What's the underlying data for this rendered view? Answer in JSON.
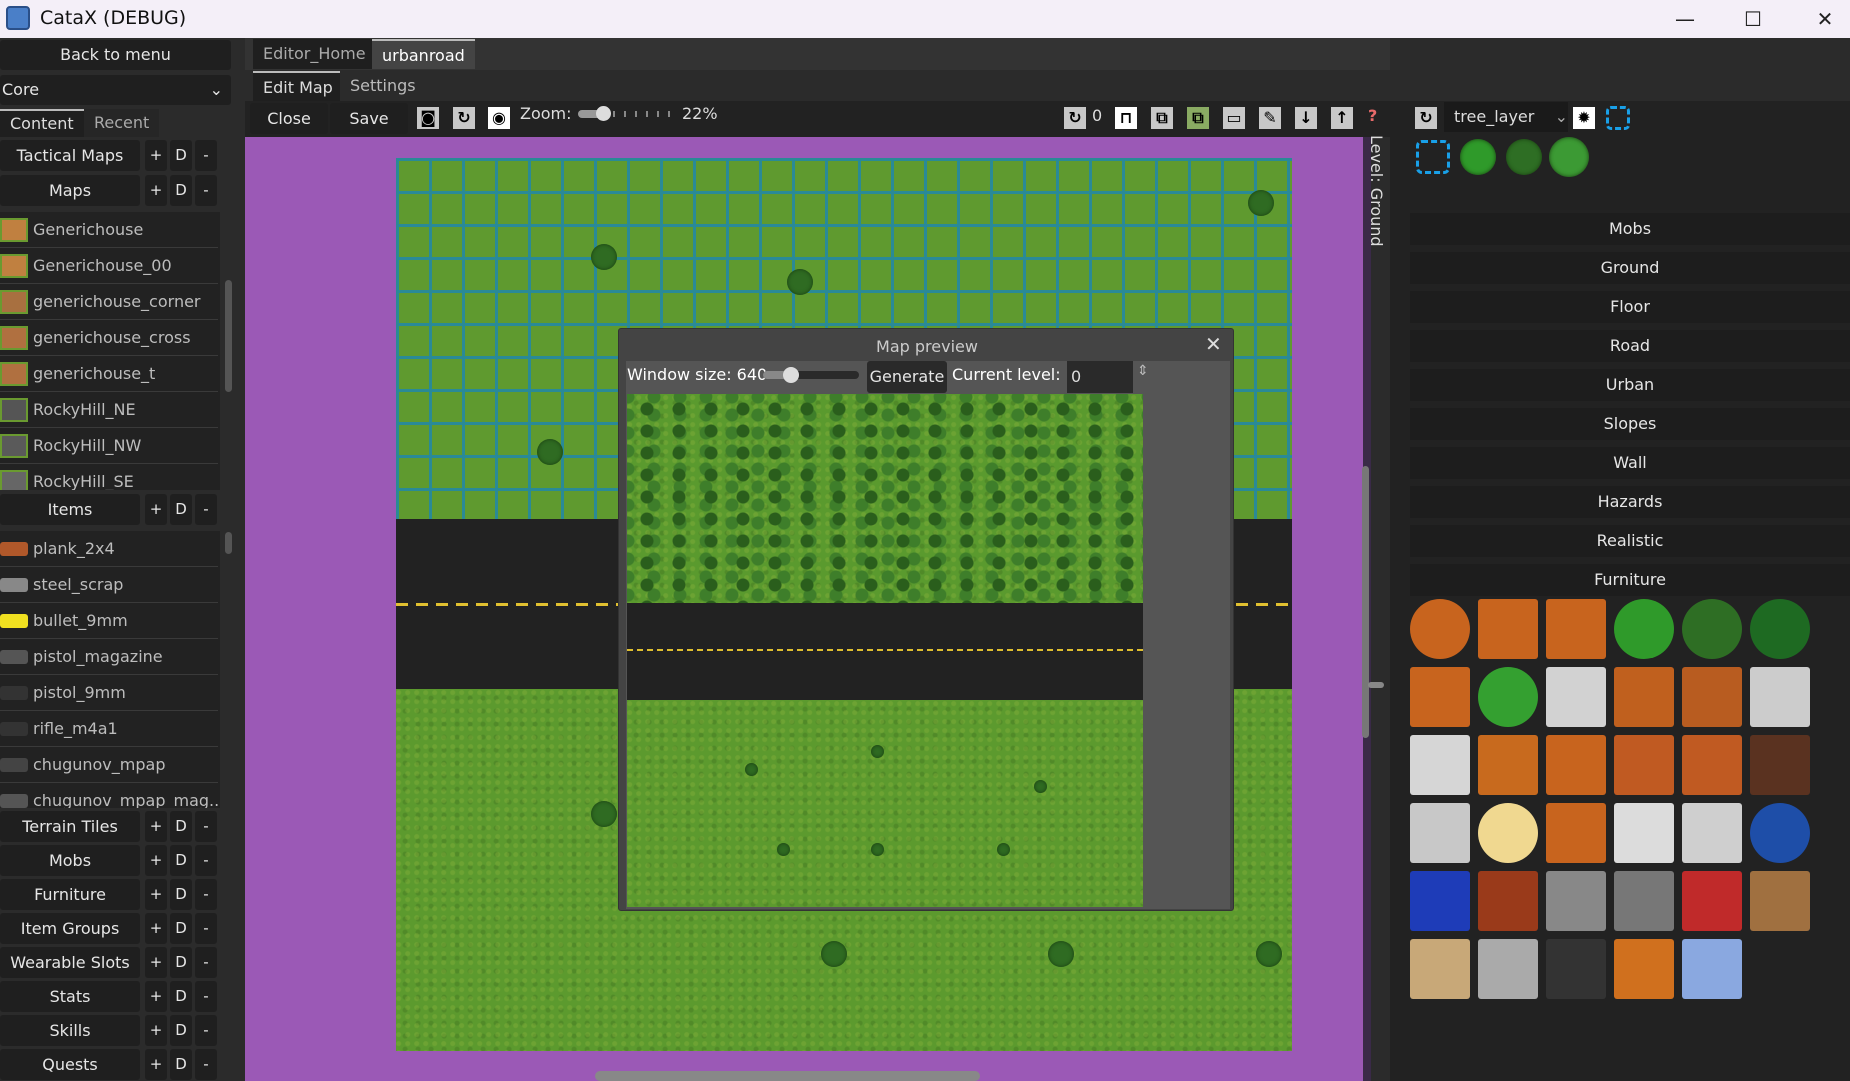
{
  "window": {
    "title": "CataX (DEBUG)",
    "minimize": "—",
    "maximize": "☐",
    "close": "✕"
  },
  "left": {
    "back_label": "Back to menu",
    "mod_select": "Core",
    "tabs": [
      "Content",
      "Recent"
    ],
    "sections_top": [
      {
        "label": "Tactical Maps"
      },
      {
        "label": "Maps"
      }
    ],
    "maps": [
      "Generichouse",
      "Generichouse_00",
      "generichouse_corner",
      "generichouse_cross",
      "generichouse_t",
      "RockyHill_NE",
      "RockyHill_NW",
      "RockyHill_SE"
    ],
    "items_label": "Items",
    "items": [
      "plank_2x4",
      "steel_scrap",
      "bullet_9mm",
      "pistol_magazine",
      "pistol_9mm",
      "rifle_m4a1",
      "chugunov_mpap",
      "chugunov_mpap_mag..."
    ],
    "sections_bottom": [
      "Terrain Tiles",
      "Mobs",
      "Furniture",
      "Item Groups",
      "Wearable Slots",
      "Stats",
      "Skills",
      "Quests"
    ],
    "section_buttons": [
      "+",
      "D",
      "-"
    ]
  },
  "editor": {
    "tabs": [
      "Editor_Home",
      "urbanroad"
    ],
    "active_tab": "urbanroad",
    "subtabs": [
      "Edit Map",
      "Settings"
    ],
    "close_label": "Close",
    "save_label": "Save",
    "zoom_label": "Zoom:",
    "zoom_value": "22%",
    "zoom_fraction": 0.22,
    "rotation_value": "0",
    "help_icon": "?",
    "level_label": "Level: Ground"
  },
  "right": {
    "layer_select": "tree_layer",
    "categories": [
      "Mobs",
      "Ground",
      "Floor",
      "Road",
      "Urban",
      "Slopes",
      "Wall",
      "Hazards",
      "Realistic",
      "Furniture"
    ],
    "furniture": [
      {
        "icon": "round-table-icon",
        "color": "#c8641e"
      },
      {
        "icon": "bed-icon",
        "color": "#c8641e"
      },
      {
        "icon": "counter-icon",
        "color": "#c8641e"
      },
      {
        "icon": "bush-icon",
        "color": "#2f9a2a"
      },
      {
        "icon": "dark-bush-icon",
        "color": "#2e6e24"
      },
      {
        "icon": "berry-bush-icon",
        "color": "#1e6a22"
      },
      {
        "icon": "table-icon",
        "color": "#c8641e"
      },
      {
        "icon": "potted-plant-icon",
        "color": "#34a030"
      },
      {
        "icon": "fridge-icon",
        "color": "#d2d2d2"
      },
      {
        "icon": "shelf-icon",
        "color": "#c0601e"
      },
      {
        "icon": "shelf-items-icon",
        "color": "#b85c20"
      },
      {
        "icon": "washer-icon",
        "color": "#cccccc"
      },
      {
        "icon": "toilet-icon",
        "color": "#d6d6d6"
      },
      {
        "icon": "bench-icon",
        "color": "#c86a1e"
      },
      {
        "icon": "crate-icon",
        "color": "#c8641e"
      },
      {
        "icon": "desk-icon",
        "color": "#c05a22"
      },
      {
        "icon": "wood-table-icon",
        "color": "#c05a22"
      },
      {
        "icon": "chair-icon",
        "color": "#5a3220"
      },
      {
        "icon": "sink-icon",
        "color": "#c8c8c8"
      },
      {
        "icon": "lamp-icon",
        "color": "#f0d890"
      },
      {
        "icon": "paper-desk-icon",
        "color": "#c8641e"
      },
      {
        "icon": "bathtub-icon",
        "color": "#dcdcdc"
      },
      {
        "icon": "stove-icon",
        "color": "#cfcfcf"
      },
      {
        "icon": "water-cooler-icon",
        "color": "#1e4ea8"
      },
      {
        "icon": "sofa-icon",
        "color": "#1e3cb8"
      },
      {
        "icon": "vending-machine-icon",
        "color": "#9a3a1a"
      },
      {
        "icon": "microwave-icon",
        "color": "#888888"
      },
      {
        "icon": "console-icon",
        "color": "#777777"
      },
      {
        "icon": "soda-machine-icon",
        "color": "#c02a2a"
      },
      {
        "icon": "bookshelf-icon",
        "color": "#a07040"
      },
      {
        "icon": "rug-icon",
        "color": "#c8a878"
      },
      {
        "icon": "fence-icon",
        "color": "#aaaaaa"
      },
      {
        "icon": "manhole-icon",
        "color": "#333333"
      },
      {
        "icon": "cabinet-icon",
        "color": "#d0701e"
      },
      {
        "icon": "water-tile-icon",
        "color": "#8aa8e0"
      }
    ]
  },
  "preview": {
    "title": "Map preview",
    "close": "✕",
    "window_size_label": "Window size: 640",
    "window_size_value": 640,
    "generate_label": "Generate",
    "current_level_label": "Current level:",
    "current_level_value": "0"
  }
}
